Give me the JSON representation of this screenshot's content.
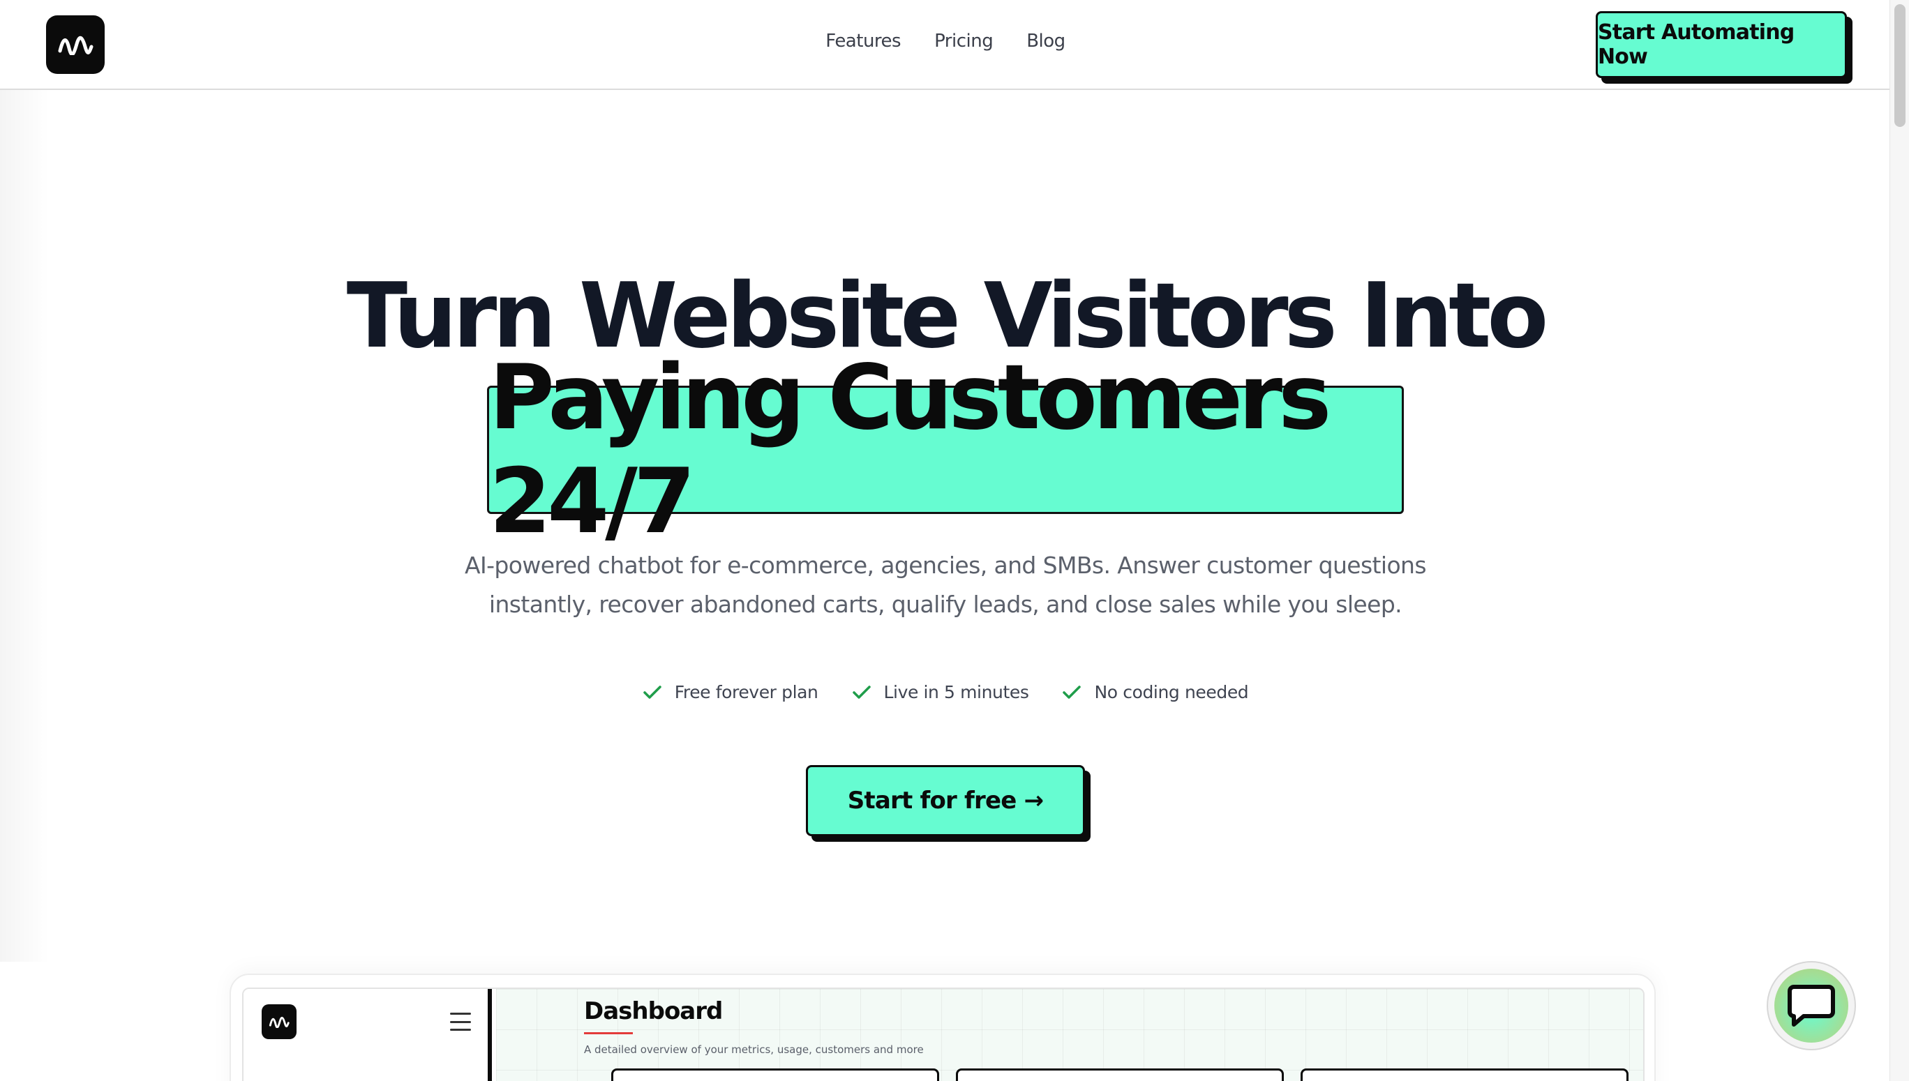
{
  "header": {
    "nav": [
      "Features",
      "Pricing",
      "Blog"
    ],
    "cta_label": "Start Automating Now"
  },
  "hero": {
    "title_line1": "Turn Website Visitors Into",
    "title_highlight": "Paying Customers 24/7",
    "subtitle_line1": "AI-powered chatbot for e-commerce, agencies, and SMBs. Answer customer questions",
    "subtitle_line2": "instantly, recover abandoned carts, qualify leads, and close sales while you sleep.",
    "features": [
      "Free forever plan",
      "Live in 5 minutes",
      "No coding needed"
    ],
    "cta_label": "Start for free →"
  },
  "preview": {
    "title": "Dashboard",
    "subtitle": "A detailed overview of your metrics, usage, customers and more"
  },
  "colors": {
    "accent": "#66fcd1",
    "ink": "#0b0b0b",
    "check": "#1f9d4a",
    "subtle_text": "#5b606b"
  },
  "icons": {
    "logo": "wave-logo-icon",
    "feature": "check-icon",
    "menu": "hamburger-menu-icon",
    "chat": "chat-bubble-icon"
  }
}
